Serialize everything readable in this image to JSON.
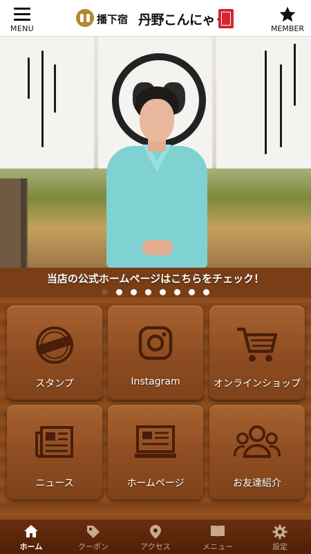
{
  "header": {
    "menu_label": "MENU",
    "member_label": "MEMBER",
    "logo_small": "播下宿",
    "logo_main": "丹野こんにゃく",
    "menu_icon": "hamburger-icon",
    "member_icon": "star-icon"
  },
  "hero": {
    "announcement": "当店の公式ホームページはこちらをチェック！",
    "dots_total": 8,
    "active_dot": 1
  },
  "tiles": [
    {
      "label": "スタンプ",
      "icon": "stamp-icon"
    },
    {
      "label": "Instagram",
      "icon": "instagram-icon"
    },
    {
      "label": "オンラインショップ",
      "icon": "cart-icon"
    },
    {
      "label": "ニュース",
      "icon": "newspaper-icon"
    },
    {
      "label": "ホームページ",
      "icon": "monitor-icon"
    },
    {
      "label": "お友達紹介",
      "icon": "friends-icon"
    }
  ],
  "bottom_nav": [
    {
      "label": "ホーム",
      "icon": "home-icon",
      "active": true
    },
    {
      "label": "クーポン",
      "icon": "coupon-tag-icon",
      "active": false
    },
    {
      "label": "アクセス",
      "icon": "location-pin-icon",
      "active": false
    },
    {
      "label": "メニュー",
      "icon": "book-icon",
      "active": false
    },
    {
      "label": "設定",
      "icon": "gear-icon",
      "active": false
    }
  ],
  "colors": {
    "header_bg": "#ffffff",
    "wood": "#8b4a1e",
    "icon_dark": "#4a1e08",
    "nav_bg": "#4e1f07"
  }
}
